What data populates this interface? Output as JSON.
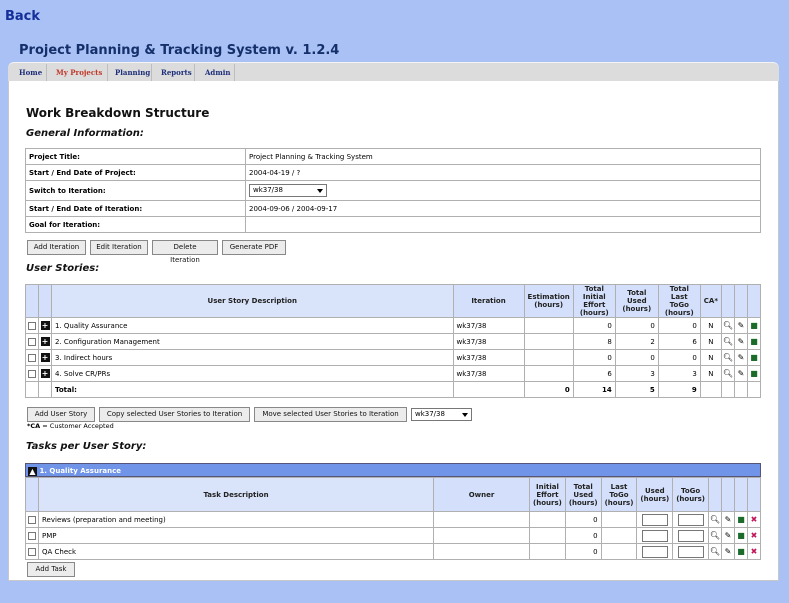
{
  "nav": {
    "back": "Back"
  },
  "app_title": "Project Planning & Tracking System v. 1.2.4",
  "tabs": [
    {
      "label": "Home"
    },
    {
      "label": "My Projects",
      "active": true
    },
    {
      "label": "Planning"
    },
    {
      "label": "Reports"
    },
    {
      "label": "Admin"
    }
  ],
  "page_title": "Work Breakdown Structure",
  "general": {
    "heading": "General Information:",
    "rows": [
      {
        "label": "Project Title:",
        "value": "Project Planning & Tracking System"
      },
      {
        "label": "Start / End Date of Project:",
        "value": "2004-04-19 / ?"
      },
      {
        "label": "Switch to Iteration:",
        "value": "wk37/38"
      },
      {
        "label": "Start / End Date of Iteration:",
        "value": "2004-09-06 / 2004-09-17"
      },
      {
        "label": "Goal for Iteration:",
        "value": ""
      }
    ]
  },
  "iteration_buttons": {
    "add": "Add Iteration",
    "edit": "Edit Iteration",
    "delete": "Delete Iteration",
    "pdf": "Generate PDF"
  },
  "stories": {
    "heading": "User Stories:",
    "headers": {
      "desc": "User Story Description",
      "iteration": "Iteration",
      "estimation": "Estimation (hours)",
      "initial": "Total Initial Effort (hours)",
      "used": "Total Used (hours)",
      "togo": "Total Last ToGo (hours)",
      "ca": "CA*"
    },
    "rows": [
      {
        "desc": "1. Quality Assurance",
        "iteration": "wk37/38",
        "estimation": "",
        "initial": "0",
        "used": "0",
        "togo": "0",
        "ca": "N"
      },
      {
        "desc": "2. Configuration Management",
        "iteration": "wk37/38",
        "estimation": "",
        "initial": "8",
        "used": "2",
        "togo": "6",
        "ca": "N"
      },
      {
        "desc": "3. Indirect hours",
        "iteration": "wk37/38",
        "estimation": "",
        "initial": "0",
        "used": "0",
        "togo": "0",
        "ca": "N"
      },
      {
        "desc": "4. Solve CR/PRs",
        "iteration": "wk37/38",
        "estimation": "",
        "initial": "6",
        "used": "3",
        "togo": "3",
        "ca": "N"
      }
    ],
    "total": {
      "label": "Total:",
      "estimation": "0",
      "initial": "14",
      "used": "5",
      "togo": "9"
    }
  },
  "story_buttons": {
    "add": "Add User Story",
    "copy": "Copy selected User Stories to Iteration",
    "move": "Move selected User Stories to Iteration",
    "target": "wk37/38"
  },
  "ca_note": {
    "abbr": "*CA",
    "text": " = Customer Accepted"
  },
  "tasks": {
    "heading": "Tasks per User Story:",
    "group": "1. Quality Assurance",
    "headers": {
      "desc": "Task Description",
      "owner": "Owner",
      "initial": "Initial Effort (hours)",
      "total_used": "Total Used (hours)",
      "last_togo": "Last ToGo (hours)",
      "used": "Used (hours)",
      "togo": "ToGo (hours)"
    },
    "rows": [
      {
        "desc": "Reviews (preparation and meeting)",
        "owner": "",
        "initial": "",
        "total_used": "0",
        "last_togo": ""
      },
      {
        "desc": "PMP",
        "owner": "",
        "initial": "",
        "total_used": "0",
        "last_togo": ""
      },
      {
        "desc": "QA Check",
        "owner": "",
        "initial": "",
        "total_used": "0",
        "last_togo": ""
      }
    ],
    "add_task": "Add Task"
  },
  "icons": {
    "view": "magnifier-icon",
    "edit": "edit-icon",
    "delete": "trash-icon",
    "remove": "remove-x-icon",
    "expand": "plus-icon",
    "collapse": "up-arrow-icon"
  },
  "colors": {
    "background": "#a9c1f4",
    "tab_bar": "#dcdcdc",
    "active_tab": "#c0392b",
    "header_cell": "#d4e0fb",
    "group_bar": "#6f94e8",
    "title": "#142f6a"
  }
}
